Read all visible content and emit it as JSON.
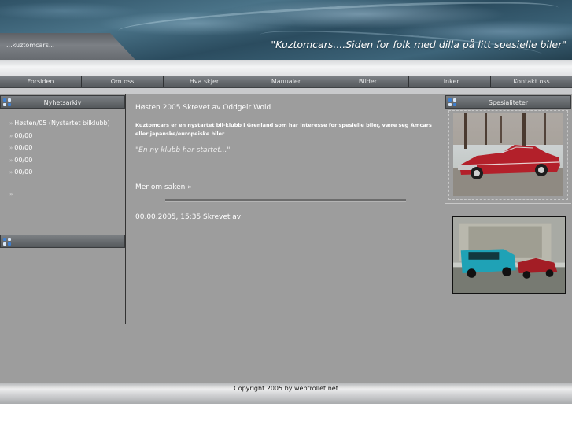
{
  "header": {
    "site_name": "...kuztomcars...",
    "tagline": "\"Kuztomcars....Siden for folk med dilla på litt spesielle biler\""
  },
  "nav": {
    "items": [
      "Forsiden",
      "Om oss",
      "Hva skjer",
      "Manualer",
      "Bilder",
      "Linker",
      "Kontakt oss"
    ]
  },
  "sidebar_left": {
    "title": "Nyhetsarkiv",
    "bullet": "»",
    "items": [
      "Høsten/05 (Nystartet bilklubb)",
      "00/00",
      "00/00",
      "00/00",
      "00/00"
    ],
    "extra": "»"
  },
  "article": {
    "heading": "Høsten 2005 Skrevet av Oddgeir Wold",
    "body": "Kuztomcars er en nystartet bil-klubb i Grenland som har interesse for spesielle biler, være seg Amcars eller japanske/europeiske biler",
    "quote": "\"En ny klubb har startet...\"",
    "read_more": "Mer om saken »",
    "second_heading": "00.00.2005, 15:35 Skrevet av"
  },
  "sidebar_right": {
    "title": "Spesialiteter"
  },
  "footer": {
    "copyright": "Copyright 2005 by webtrollet.net"
  },
  "colors": {
    "header_water": "#3d6479",
    "nav_bg": "#64686c",
    "main_bg": "#9d9d9d",
    "icon_blue": "#3e7fd0"
  },
  "icons": [
    "dots-icon"
  ]
}
